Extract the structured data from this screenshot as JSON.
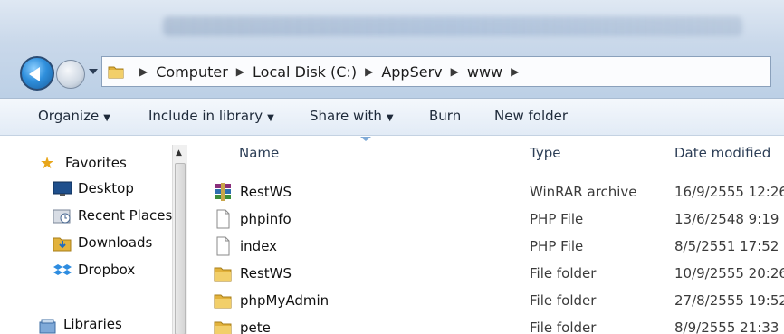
{
  "window": {
    "breadcrumbs": [
      "Computer",
      "Local Disk (C:)",
      "AppServ",
      "www"
    ]
  },
  "toolbar": {
    "organize": "Organize",
    "include_in_library": "Include in library",
    "share_with": "Share with",
    "burn": "Burn",
    "new_folder": "New folder"
  },
  "sidebar": {
    "favorites": "Favorites",
    "items": [
      {
        "label": "Desktop",
        "icon": "desktop-icon"
      },
      {
        "label": "Recent Places",
        "icon": "recent-places-icon"
      },
      {
        "label": "Downloads",
        "icon": "downloads-icon"
      },
      {
        "label": "Dropbox",
        "icon": "dropbox-icon"
      }
    ],
    "libraries": "Libraries"
  },
  "columns": {
    "name": "Name",
    "type": "Type",
    "date_modified": "Date modified"
  },
  "files": [
    {
      "name": "RestWS",
      "type": "WinRAR archive",
      "date": "16/9/2555 12:26",
      "icon": "winrar-icon"
    },
    {
      "name": "phpinfo",
      "type": "PHP File",
      "date": "13/6/2548 9:19",
      "icon": "file-icon"
    },
    {
      "name": "index",
      "type": "PHP File",
      "date": "8/5/2551 17:52",
      "icon": "file-icon"
    },
    {
      "name": "RestWS",
      "type": "File folder",
      "date": "10/9/2555 20:26",
      "icon": "folder-icon"
    },
    {
      "name": "phpMyAdmin",
      "type": "File folder",
      "date": "27/8/2555 19:52",
      "icon": "folder-icon"
    },
    {
      "name": "pete",
      "type": "File folder",
      "date": "8/9/2555 21:33",
      "icon": "folder-icon"
    }
  ],
  "colors": {
    "folder": "#e2b23c",
    "accent": "#2f8fdc"
  }
}
